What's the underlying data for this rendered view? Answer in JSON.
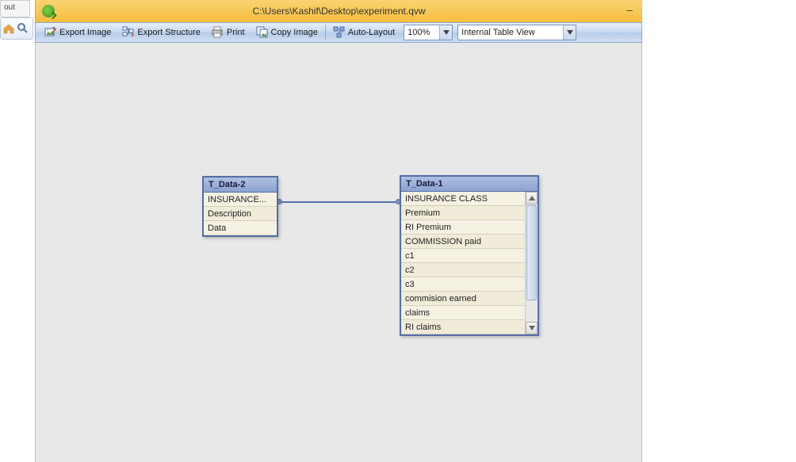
{
  "leftTab": "out",
  "window": {
    "title": "C:\\Users\\Kashif\\Desktop\\experiment.qvw"
  },
  "toolbar": {
    "exportImage": "Export Image",
    "exportStructure": "Export Structure",
    "print": "Print",
    "copyImage": "Copy Image",
    "autoLayout": "Auto-Layout",
    "zoom": "100%",
    "viewMode": "Internal Table View"
  },
  "tables": {
    "t2": {
      "name": "T_Data-2",
      "fields": [
        "INSURANCE...",
        "Description",
        "Data"
      ]
    },
    "t1": {
      "name": "T_Data-1",
      "fields": [
        "INSURANCE CLASS",
        "Premium",
        "RI Premium",
        "COMMISSION paid",
        "c1",
        "c2",
        "c3",
        "commision earned",
        "claims",
        "RI claims"
      ]
    }
  }
}
